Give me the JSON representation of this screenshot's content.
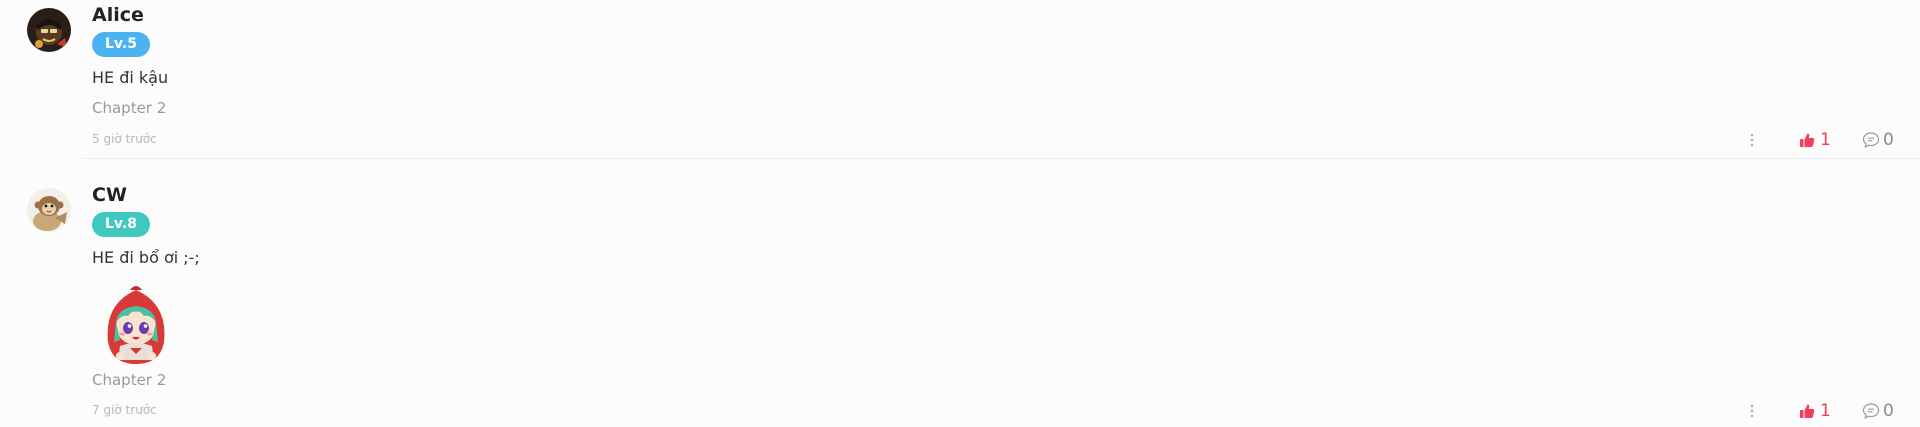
{
  "comments": [
    {
      "username": "Alice",
      "level": "Lv.5",
      "level_color": "#4ab3f0",
      "text": "HE đi kậu",
      "chapter": "Chapter 2",
      "time": "5 giờ trước",
      "likes": "1",
      "replies": "0",
      "avatar_icon": "dark-character-avatar"
    },
    {
      "username": "CW",
      "level": "Lv.8",
      "level_color": "#3fc8c0",
      "text": "HE đi bổ ơi ;-;",
      "chapter": "Chapter 2",
      "time": "7 giờ trước",
      "likes": "1",
      "replies": "0",
      "avatar_icon": "monkey-avatar",
      "sticker_icon": "red-hood-girl-sticker"
    }
  ],
  "colors": {
    "like": "#f0405a",
    "muted": "#9a9a9a"
  }
}
